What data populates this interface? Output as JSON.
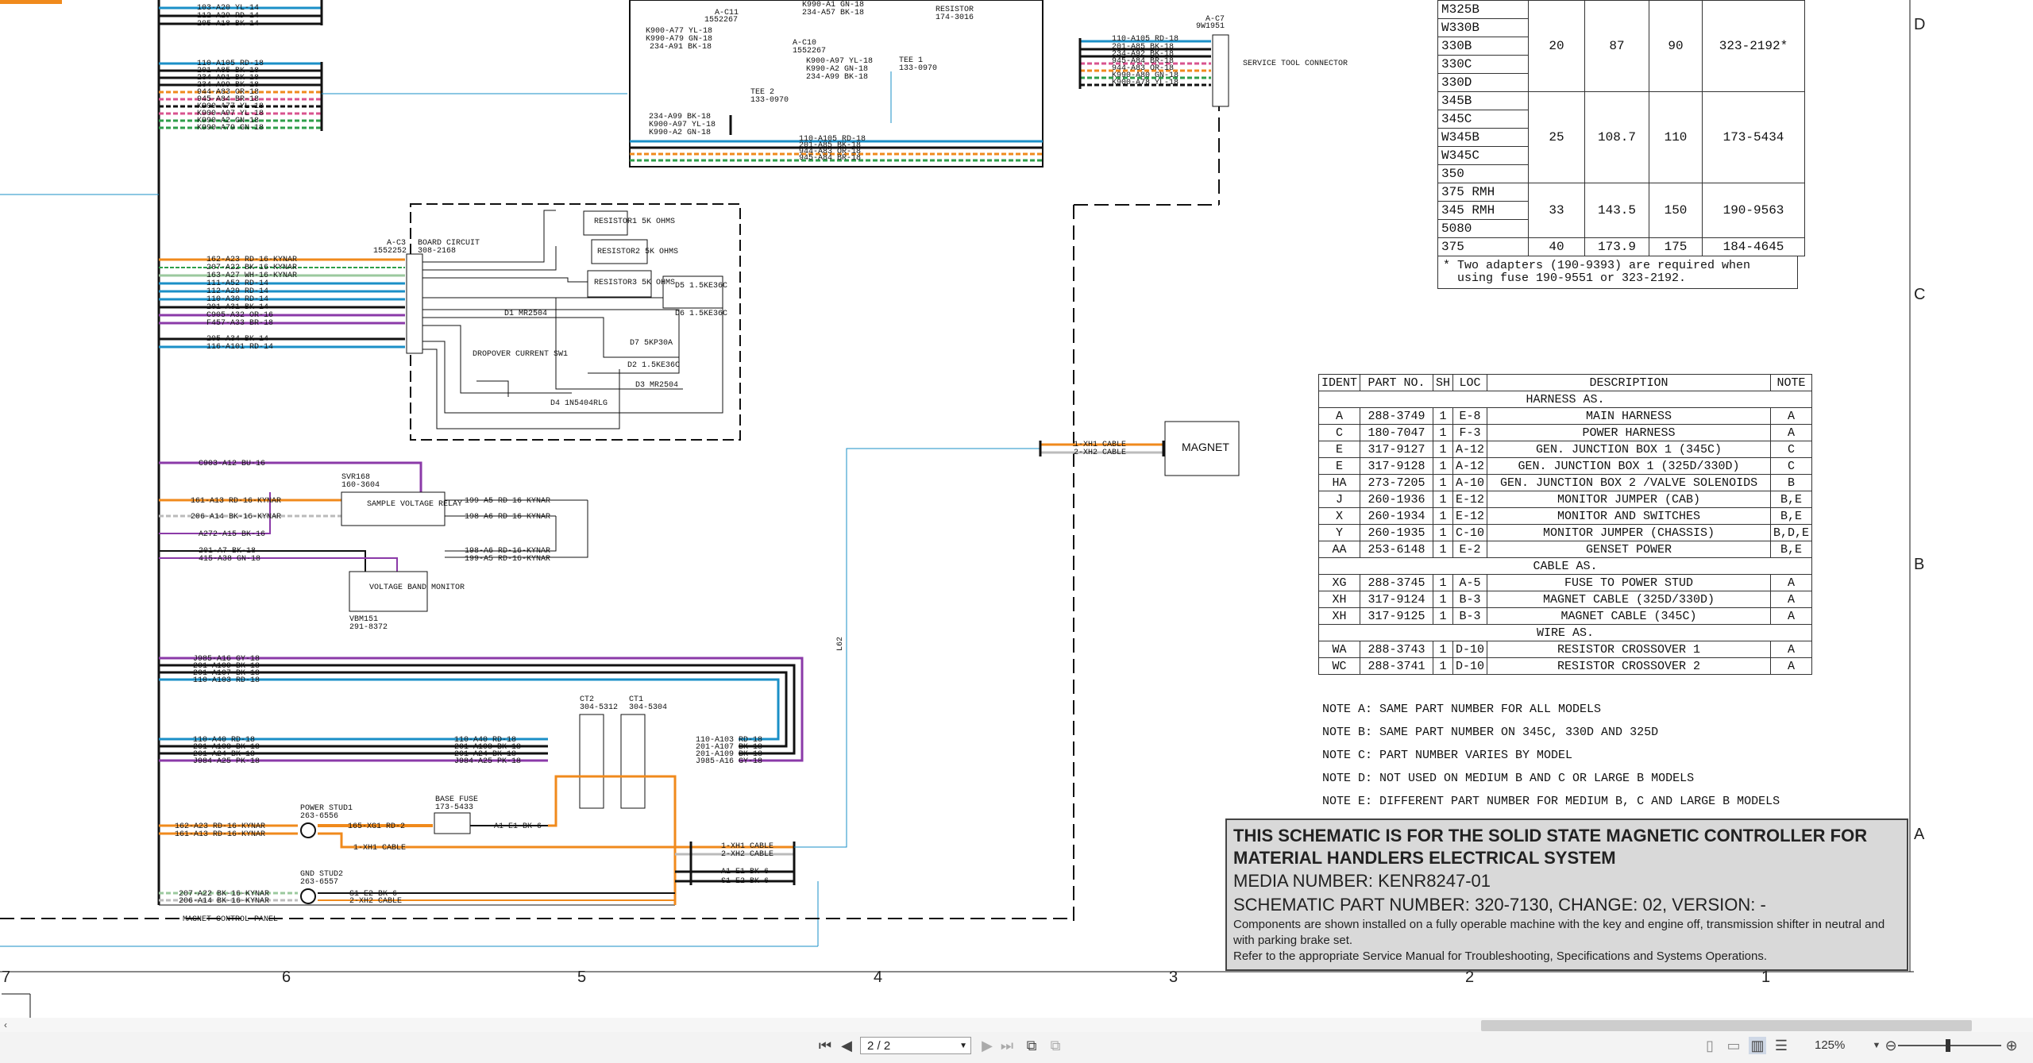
{
  "viewer": {
    "page_display": "2 / 2",
    "zoom": "125%"
  },
  "schematic": {
    "wires_top_left": [
      "103-A20 YL-14",
      "112-A29 RD-14",
      "205-A18 BK-14"
    ],
    "wires_left_group2": [
      "110-A105 RD-18",
      "201-A85 BK-18",
      "234-A91 BK-18",
      "234-A99 BK-18",
      "944-A83 OR-18",
      "945-A84 BR-18",
      "K900-A77 YL-18",
      "K900-A97 YL-18",
      "K990-A2 GN-18",
      "K990-A79 GN-18"
    ],
    "c11": {
      "name": "A-C11",
      "part": "1552267"
    },
    "c11_wires": [
      "K900-A77 YL-18",
      "K990-A79 GN-18",
      "234-A91 BK-18"
    ],
    "c10": {
      "name": "A-C10",
      "part": "1552267"
    },
    "c10_wires": [
      "K900-A97 YL-18",
      "K990-A2 GN-18",
      "234-A99 BK-18"
    ],
    "top_wires_a": [
      "K990-A1 GN-18",
      "234-A57 BK-18"
    ],
    "resistor_top": {
      "name": "RESISTOR",
      "part": "174-3016"
    },
    "tee1": {
      "name": "TEE 1",
      "part": "133-0970"
    },
    "tee2": {
      "name": "TEE 2",
      "part": "133-0970"
    },
    "tee2_wires": [
      "234-A99 BK-18",
      "K900-A97 YL-18",
      "K990-A2 GN-18"
    ],
    "bus_wires": [
      "110-A105 RD-18",
      "201-A85 BK-18",
      "944-A83 OR-18",
      "945-A84 BR-18"
    ],
    "c7": {
      "name": "A-C7",
      "part": "9W1951"
    },
    "c7_wires": [
      "110-A105 RD-18",
      "201-A85 BK-18",
      "234-A92 BK-18",
      "945-A84 BR-18",
      "944-A83 OR-18",
      "K990-A80 GN-18",
      "K900-A78 YL-18"
    ],
    "service_tool": "SERVICE TOOL CONNECTOR",
    "c3": {
      "name": "A-C3",
      "part": "1552252"
    },
    "board": {
      "name": "BOARD CIRCUIT",
      "part": "308-2168"
    },
    "c3_wires": [
      "162-A23 RD-16-KYNAR",
      "207-A22 BK-16-KYNAR",
      "163-A27 WH-16-KYNAR",
      "111-A52 RD-14",
      "112-A29 RD-14",
      "110-A30 RD-14",
      "201-A31 BK-14",
      "C905-A32 OR-16",
      "F457-A33 BR-18",
      "",
      "205-A34 BK-14",
      "116-A101 RD-14"
    ],
    "resistor1": "RESISTOR1 5K OHMS",
    "resistor2": "RESISTOR2 5K OHMS",
    "resistor3": "RESISTOR3 5K OHMS",
    "d1": "D1 MR2504",
    "d2": "D2 1.5KE36C",
    "d3": "D3 MR2504",
    "d4": "D4 1N5404RLG",
    "d5": "D5 1.5KE36C",
    "d6": "D6 1.5KE36C",
    "d7": "D7 5KP30A",
    "dropover": "DROPOVER CURRENT SW1",
    "svr": {
      "name": "SVR168",
      "part": "160-3604",
      "label": "SAMPLE VOLTAGE RELAY"
    },
    "svr_left": [
      "C903-A12 BU-16",
      "161-A13 RD-16-KYNAR",
      "206-A14 BK-16-KYNAR",
      "A272-A15 BK-16",
      "201-A7 BK-18",
      "415-A38 GN-18"
    ],
    "svr_right": [
      "199-A5 RD-16-KYNAR",
      "198-A6 RD-16-KYNAR",
      "198-A6 RD-16-KYNAR",
      "199-A5 RD-16-KYNAR"
    ],
    "vbm": {
      "name": "VBM151",
      "part": "291-8372",
      "label": "VOLTAGE BAND MONITOR"
    },
    "purple_wires": [
      "J985-A16 GY-18",
      "201-A109 BK-18",
      "201-A107 BK-18",
      "110-A103 RD-18"
    ],
    "ct_left_wires": [
      "110-A40 RD-18",
      "201-A108 BK-18",
      "201-A24 BK-18",
      "J984-A25 PK-18"
    ],
    "ct_mid_wires": [
      "110-A40 RD-18",
      "201-A108 BK-18",
      "201-A24 BK-18",
      "J984-A25 PK-18"
    ],
    "ct_right_wires": [
      "110-A103 RD-18",
      "201-A107 BK-18",
      "201-A109 BK-18",
      "J985-A16 GY-18"
    ],
    "ct2": {
      "name": "CT2",
      "part": "304-5312"
    },
    "ct1": {
      "name": "CT1",
      "part": "304-5304"
    },
    "power_stud": {
      "name": "POWER STUD1",
      "part": "263-6556"
    },
    "power_stud_wires": [
      "162-A23 RD-16-KYNAR",
      "161-A13 RD-16-KYNAR"
    ],
    "base_fuse": {
      "name": "BASE FUSE",
      "part": "173-5433"
    },
    "fuse_wires": [
      "165-XG1 RD-2",
      "A1-E1 BK-6",
      "1-XH1 CABLE"
    ],
    "gnd_stud": {
      "name": "GND STUD2",
      "part": "263-6557"
    },
    "gnd_wires": [
      "207-A22 BK-16-KYNAR",
      "206-A14 BK-16-KYNAR",
      "S1-E2 BK-6",
      "2-XH2 CABLE"
    ],
    "cable_out": [
      "1-XH1 CABLE",
      "2-XH2 CABLE",
      "A1-E1 BK-6",
      "S1-E2 BK-6"
    ],
    "magnet_cable": [
      "1-XH1 CABLE",
      "2-XH2 CABLE"
    ],
    "magnet": "MAGNET",
    "l62": "L62",
    "panel": "MAGNET CONTROL PANEL"
  },
  "adapter_table": [
    {
      "models": [
        "M325B",
        "W330B",
        "330B",
        "330C",
        "330D"
      ],
      "a": "20",
      "b": "87",
      "c": "90",
      "part": "323-2192*"
    },
    {
      "models": [
        "345B",
        "345C",
        "W345B",
        "W345C",
        "350"
      ],
      "a": "25",
      "b": "108.7",
      "c": "110",
      "part": "173-5434"
    },
    {
      "models": [
        "375 RMH",
        "345 RMH",
        "5080"
      ],
      "a": "33",
      "b": "143.5",
      "c": "150",
      "part": "190-9563"
    },
    {
      "models": [
        "375"
      ],
      "a": "40",
      "b": "173.9",
      "c": "175",
      "part": "184-4645"
    }
  ],
  "adapter_note": "* Two adapters (190-9393) are required when\n  using fuse 190-9551 or 323-2192.",
  "parts_table": {
    "headers": [
      "IDENT",
      "PART NO.",
      "SH",
      "LOC",
      "DESCRIPTION",
      "NOTE"
    ],
    "groups": [
      {
        "title": "HARNESS AS.",
        "rows": [
          [
            "A",
            "288-3749",
            "1",
            "E-8",
            "MAIN HARNESS",
            "A"
          ],
          [
            "C",
            "180-7047",
            "1",
            "F-3",
            "POWER HARNESS",
            "A"
          ],
          [
            "E",
            "317-9127",
            "1",
            "A-12",
            "GEN. JUNCTION BOX 1 (345C)",
            "C"
          ],
          [
            "E",
            "317-9128",
            "1",
            "A-12",
            "GEN. JUNCTION BOX 1 (325D/330D)",
            "C"
          ],
          [
            "HA",
            "273-7205",
            "1",
            "A-10",
            "GEN. JUNCTION BOX 2 /VALVE SOLENOIDS",
            "B"
          ],
          [
            "J",
            "260-1936",
            "1",
            "E-12",
            "MONITOR JUMPER (CAB)",
            "B,E"
          ],
          [
            "X",
            "260-1934",
            "1",
            "E-12",
            "MONITOR AND SWITCHES",
            "B,E"
          ],
          [
            "Y",
            "260-1935",
            "1",
            "C-10",
            "MONITOR JUMPER (CHASSIS)",
            "B,D,E"
          ],
          [
            "AA",
            "253-6148",
            "1",
            "E-2",
            "GENSET POWER",
            "B,E"
          ]
        ]
      },
      {
        "title": "CABLE AS.",
        "rows": [
          [
            "XG",
            "288-3745",
            "1",
            "A-5",
            "FUSE TO POWER STUD",
            "A"
          ],
          [
            "XH",
            "317-9124",
            "1",
            "B-3",
            "MAGNET CABLE (325D/330D)",
            "A"
          ],
          [
            "XH",
            "317-9125",
            "1",
            "B-3",
            "MAGNET CABLE (345C)",
            "A"
          ]
        ]
      },
      {
        "title": "WIRE AS.",
        "rows": [
          [
            "WA",
            "288-3743",
            "1",
            "D-10",
            "RESISTOR CROSSOVER 1",
            "A"
          ],
          [
            "WC",
            "288-3741",
            "1",
            "D-10",
            "RESISTOR CROSSOVER 2",
            "A"
          ]
        ]
      }
    ]
  },
  "notes": [
    "NOTE A: SAME PART NUMBER FOR ALL MODELS",
    "NOTE B: SAME PART NUMBER ON 345C, 330D AND 325D",
    "NOTE C: PART NUMBER VARIES BY MODEL",
    "NOTE D: NOT USED ON MEDIUM B AND C OR LARGE B MODELS",
    "NOTE E: DIFFERENT PART NUMBER FOR MEDIUM B, C AND LARGE B MODELS"
  ],
  "title_block": {
    "heading": "THIS SCHEMATIC IS FOR THE SOLID STATE MAGNETIC CONTROLLER FOR MATERIAL HANDLERS ELECTRICAL SYSTEM",
    "media": "MEDIA NUMBER: KENR8247-01",
    "part": "SCHEMATIC PART NUMBER: 320-7130, CHANGE: 02, VERSION: -",
    "desc1": "Components are shown installed on a fully operable machine with the key and engine off, transmission shifter in neutral and with parking brake set.",
    "desc2": "Refer to the appropriate Service Manual for Troubleshooting, Specifications and Systems Operations."
  },
  "grid": {
    "columns": [
      "7",
      "6",
      "5",
      "4",
      "3",
      "2",
      "1"
    ],
    "rows": [
      "D",
      "C",
      "B",
      "A"
    ]
  },
  "colors": {
    "orange": "#f08a1c",
    "blue": "#1a8fc7",
    "purple": "#8b3aa8",
    "green": "#2e9e4a",
    "black": "#111111",
    "pink": "#d8538f",
    "grey": "#888888"
  }
}
